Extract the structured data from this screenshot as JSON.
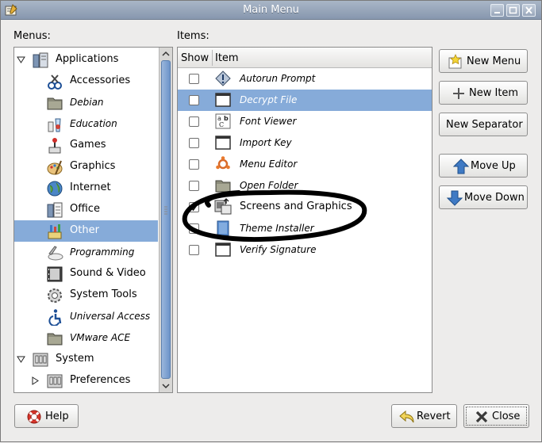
{
  "window": {
    "title": "Main Menu"
  },
  "menus": {
    "label": "Menus:",
    "tree": [
      {
        "label": "Applications",
        "italic": false,
        "icon": "applications-icon",
        "level": 0,
        "expander": "expanded"
      },
      {
        "label": "Accessories",
        "italic": false,
        "icon": "accessories-icon",
        "level": 1
      },
      {
        "label": "Debian",
        "italic": true,
        "icon": "folder-icon",
        "level": 1
      },
      {
        "label": "Education",
        "italic": true,
        "icon": "education-icon",
        "level": 1
      },
      {
        "label": "Games",
        "italic": false,
        "icon": "games-icon",
        "level": 1
      },
      {
        "label": "Graphics",
        "italic": false,
        "icon": "graphics-icon",
        "level": 1
      },
      {
        "label": "Internet",
        "italic": false,
        "icon": "internet-icon",
        "level": 1
      },
      {
        "label": "Office",
        "italic": false,
        "icon": "office-icon",
        "level": 1
      },
      {
        "label": "Other",
        "italic": false,
        "icon": "other-icon",
        "level": 1,
        "selected": true
      },
      {
        "label": "Programming",
        "italic": true,
        "icon": "programming-icon",
        "level": 1
      },
      {
        "label": "Sound & Video",
        "italic": false,
        "icon": "sound-video-icon",
        "level": 1
      },
      {
        "label": "System Tools",
        "italic": false,
        "icon": "system-tools-icon",
        "level": 1
      },
      {
        "label": "Universal Access",
        "italic": true,
        "icon": "universal-access-icon",
        "level": 1
      },
      {
        "label": "VMware ACE",
        "italic": true,
        "icon": "folder-icon",
        "level": 1
      },
      {
        "label": "System",
        "italic": false,
        "icon": "system-icon",
        "level": 0,
        "expander": "expanded"
      },
      {
        "label": "Preferences",
        "italic": false,
        "icon": "preferences-icon",
        "level": 1,
        "expander": "collapsed"
      }
    ]
  },
  "items": {
    "label": "Items:",
    "columns": {
      "show": "Show",
      "item": "Item"
    },
    "rows": [
      {
        "label": "Autorun Prompt",
        "checked": false,
        "italic": true,
        "icon": "autorun-icon"
      },
      {
        "label": "Decrypt File",
        "checked": false,
        "italic": true,
        "icon": "window-icon",
        "selected": true
      },
      {
        "label": "Font Viewer",
        "checked": false,
        "italic": true,
        "icon": "font-viewer-icon"
      },
      {
        "label": "Import Key",
        "checked": false,
        "italic": true,
        "icon": "window-icon"
      },
      {
        "label": "Menu Editor",
        "checked": false,
        "italic": true,
        "icon": "menu-editor-icon"
      },
      {
        "label": "Open Folder",
        "checked": false,
        "italic": true,
        "icon": "folder-icon"
      },
      {
        "label": "Screens and Graphics",
        "checked": true,
        "italic": false,
        "icon": "screens-graphics-icon"
      },
      {
        "label": "Theme Installer",
        "checked": false,
        "italic": true,
        "icon": "theme-installer-icon"
      },
      {
        "label": "Verify Signature",
        "checked": false,
        "italic": true,
        "icon": "window-icon"
      }
    ]
  },
  "buttons": {
    "new_menu": "New Menu",
    "new_item": "New Item",
    "new_separator": "New Separator",
    "move_up": "Move Up",
    "move_down": "Move Down",
    "help": "Help",
    "revert": "Revert",
    "close": "Close"
  },
  "colors": {
    "selection": "#86abd9",
    "titlebar": "#8797ae",
    "annotation": "#000000"
  }
}
